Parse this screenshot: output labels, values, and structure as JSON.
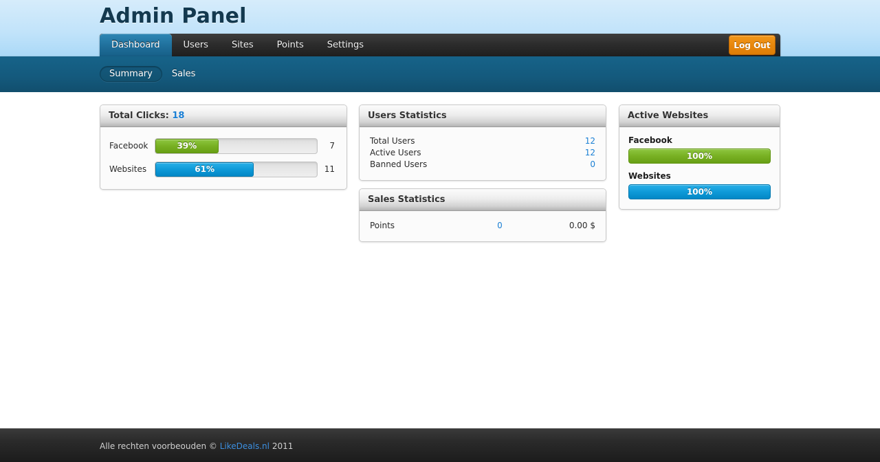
{
  "header": {
    "title": "Admin Panel"
  },
  "nav": {
    "items": [
      {
        "label": "Dashboard",
        "active": true
      },
      {
        "label": "Users",
        "active": false
      },
      {
        "label": "Sites",
        "active": false
      },
      {
        "label": "Points",
        "active": false
      },
      {
        "label": "Settings",
        "active": false
      }
    ],
    "logout_label": "Log Out"
  },
  "subnav": {
    "items": [
      {
        "label": "Summary",
        "active": true
      },
      {
        "label": "Sales",
        "active": false
      }
    ]
  },
  "panels": {
    "total_clicks": {
      "title_prefix": "Total Clicks: ",
      "title_value": "18",
      "rows": [
        {
          "label": "Facebook",
          "percent_label": "39%",
          "percent": 39,
          "count": "7",
          "color": "green"
        },
        {
          "label": "Websites",
          "percent_label": "61%",
          "percent": 61,
          "count": "11",
          "color": "blue"
        }
      ]
    },
    "users_statistics": {
      "title": "Users Statistics",
      "rows": [
        {
          "label": "Total Users",
          "value": "12"
        },
        {
          "label": "Active Users",
          "value": "12"
        },
        {
          "label": "Banned Users",
          "value": "0"
        }
      ]
    },
    "sales_statistics": {
      "title": "Sales Statistics",
      "rows": [
        {
          "label": "Points",
          "points": "0",
          "amount": "0.00 $"
        }
      ]
    },
    "active_websites": {
      "title": "Active Websites",
      "rows": [
        {
          "label": "Facebook",
          "percent_label": "100%",
          "percent": 100,
          "color": "green"
        },
        {
          "label": "Websites",
          "percent_label": "100%",
          "percent": 100,
          "color": "blue"
        }
      ]
    }
  },
  "footer": {
    "prefix": "Alle rechten voorbeouden © ",
    "link": "LikeDeals.nl",
    "suffix": " 2011"
  },
  "colors": {
    "accent_blue": "#1a7fd4",
    "bar_green": "#78b023",
    "bar_blue": "#0f9ad8",
    "logout_orange": "#e8870c",
    "subnav_teal": "#14597c"
  }
}
